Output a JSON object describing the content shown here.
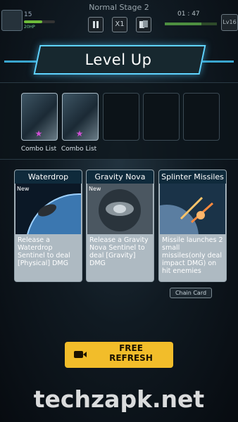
{
  "header": {
    "stage_title": "Normal Stage 2",
    "hp_value": "15",
    "hp_label": "20HP",
    "hp_fraction": 0.6,
    "speed_label": "X1",
    "timer": "01 : 47",
    "level": "Lv16",
    "timer_bar_fraction": 0.7
  },
  "banner": {
    "title": "Level Up"
  },
  "combo_slots": [
    {
      "label": "Combo List",
      "star": "★"
    },
    {
      "label": "Combo List",
      "star": "★"
    }
  ],
  "cards": [
    {
      "title": "Waterdrop",
      "badge": "New",
      "desc": "Release a Waterdrop Sentinel to deal [Physical] DMG"
    },
    {
      "title": "Gravity Nova",
      "badge": "New",
      "desc": "Release a Gravity Nova Sentinel to deal [Gravity] DMG"
    },
    {
      "title": "Splinter Missiles",
      "badge": "",
      "desc": "Missile launches 2 small missiles(only deal impact DMG) on hit enemies"
    }
  ],
  "chain_card_label": "Chain Card",
  "refresh_label": "FREE\nREFRESH",
  "watermark": "techzapk.net",
  "colors": {
    "accent": "#5fd3ff",
    "button": "#f2bd2a",
    "star": "#d04fd6"
  }
}
